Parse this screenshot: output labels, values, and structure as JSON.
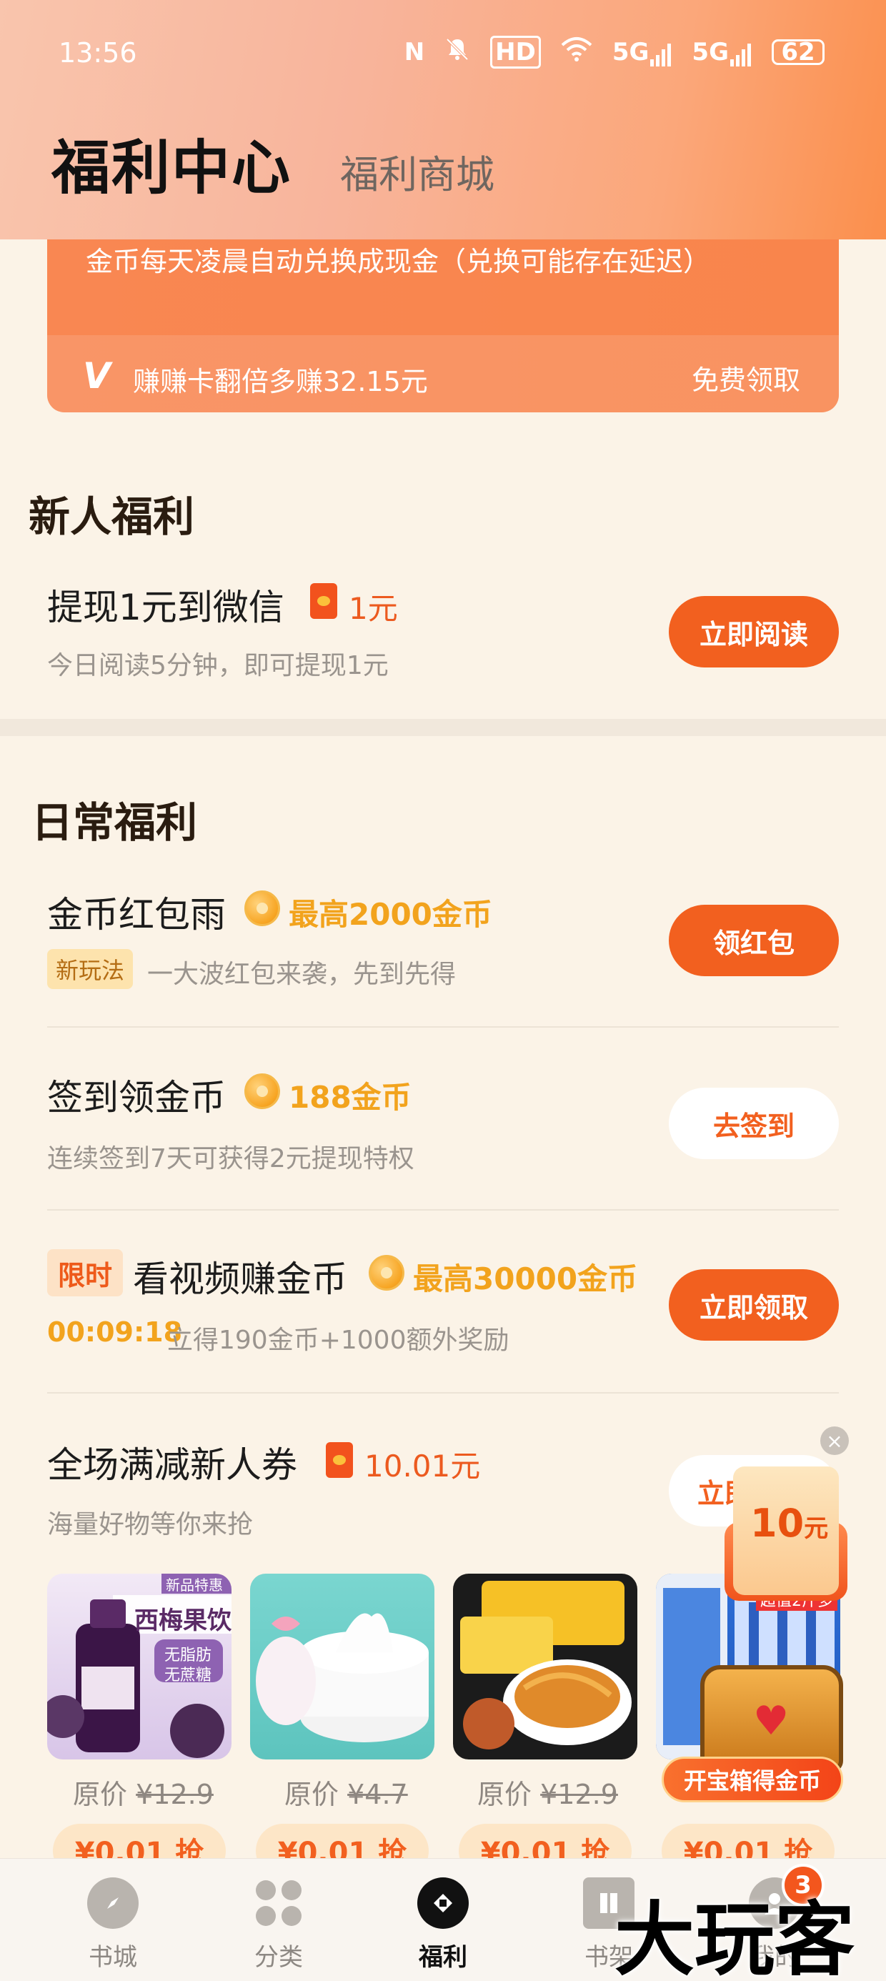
{
  "status_bar": {
    "time": "13:56",
    "nfc": "N",
    "mute_icon": "bell-off-icon",
    "hd": "HD",
    "sig1": "5G",
    "sig2": "5G",
    "battery": "62"
  },
  "header": {
    "title": "福利中心",
    "tab_mall": "福利商城"
  },
  "top_card": {
    "note": "金币每天凌晨自动兑换成现金（兑换可能存在延迟）",
    "tip": "赚赚卡翻倍多赚32.15元",
    "link": "免费领取"
  },
  "newcomer": {
    "section_title": "新人福利",
    "task_title": "提现1元到微信",
    "reward": "1元",
    "desc": "今日阅读5分钟，即可提现1元",
    "button": "立即阅读"
  },
  "daily": {
    "section_title": "日常福利",
    "tasks": [
      {
        "title": "金币红包雨",
        "reward": "最高2000金币",
        "tag": "新玩法",
        "desc": "一大波红包来袭，先到先得",
        "button": "领红包"
      },
      {
        "title": "签到领金币",
        "reward": "188金币",
        "desc": "连续签到7天可获得2元提现特权",
        "button": "去签到"
      },
      {
        "tag": "限时",
        "title": "看视频赚金币",
        "reward": "最高30000金币",
        "countdown": "00:09:18",
        "desc": "立得190金币+1000额外奖励",
        "button": "立即领取"
      },
      {
        "title": "全场满减新人券",
        "reward": "10.01元",
        "desc": "海量好物等你来抢",
        "button": "立即"
      }
    ]
  },
  "products": [
    {
      "label": "原价",
      "price": "¥12.9",
      "buy": "¥0.01 抢",
      "top_text": "新品特惠",
      "name": "西梅果饮",
      "sub1": "无脂肪",
      "sub2": "无蔗糖"
    },
    {
      "label": "原价",
      "price": "¥4.7",
      "buy": "¥0.01 抢"
    },
    {
      "label": "原价",
      "price": "¥12.9",
      "buy": "¥0.01 抢"
    },
    {
      "buy": "¥0.01 抢",
      "top_text": "超值2斤多"
    }
  ],
  "float_widget": {
    "amount": "10",
    "unit": "元",
    "close": "×",
    "chest_label": "开宝箱得金币"
  },
  "bottom_nav": [
    {
      "label": "书城",
      "icon": "compass-icon"
    },
    {
      "label": "分类",
      "icon": "grid-icon"
    },
    {
      "label": "福利",
      "icon": "gift-icon"
    },
    {
      "label": "书架",
      "icon": "book-icon"
    },
    {
      "label": "我的",
      "icon": "user-icon"
    }
  ],
  "nav_badge": "3",
  "watermark": "大玩客",
  "colors": {
    "accent": "#f2601f",
    "coin_text": "#f2801f",
    "background": "#fbf3e7"
  }
}
